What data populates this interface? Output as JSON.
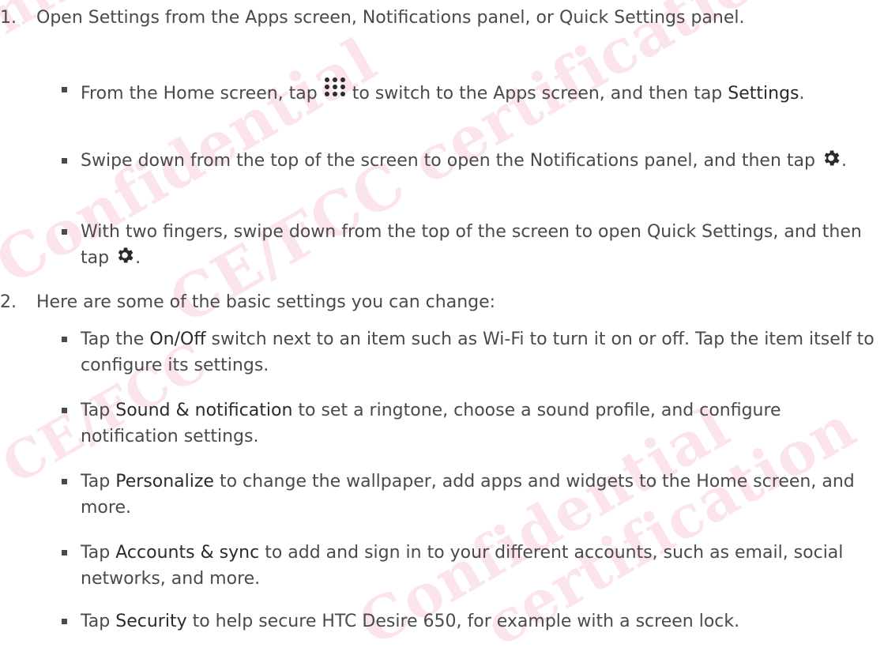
{
  "watermarks": [
    "Confidential",
    "CE/FCC certification",
    "CE/FCC",
    "Confidential",
    "certification",
    "Confidential"
  ],
  "steps": [
    {
      "number": "1.",
      "text": "Open Settings from the Apps screen, Notifications panel, or Quick Settings panel."
    },
    {
      "number": "2.",
      "text": "Here are some of the basic settings you can change:"
    }
  ],
  "bullets": {
    "b1": {
      "pre": "From the Home screen, tap ",
      "mid": " to switch to the Apps screen, and then tap ",
      "strong": "Settings",
      "post": "."
    },
    "b2": {
      "pre": "Swipe down from the top of the screen to open the Notifications panel, and then tap ",
      "post": "."
    },
    "b3": {
      "pre": "With two fingers, swipe down from the top of the screen to open Quick Settings, and then tap ",
      "post": "."
    },
    "b4": {
      "pre": "Tap the ",
      "strong": "On/Off",
      "post": "  switch next to an item such as Wi-Fi to turn it on or off. Tap the item itself to configure its settings."
    },
    "b5": {
      "pre": "Tap ",
      "strong": "Sound & notification",
      "post": " to set a ringtone, choose a sound profile, and configure notification settings."
    },
    "b6": {
      "pre": "Tap ",
      "strong": "Personalize",
      "post": " to change the wallpaper, add apps and widgets to the Home screen, and more."
    },
    "b7": {
      "pre": "Tap ",
      "strong": "Accounts & sync",
      "post": " to add and sign in to your different accounts, such as email, social networks, and more."
    },
    "b8": {
      "pre": "Tap ",
      "strong": "Security",
      "post": " to help secure HTC Desire 650, for example with a screen lock."
    }
  },
  "icons": {
    "apps": "apps-grid-icon",
    "settings": "gear-icon"
  }
}
